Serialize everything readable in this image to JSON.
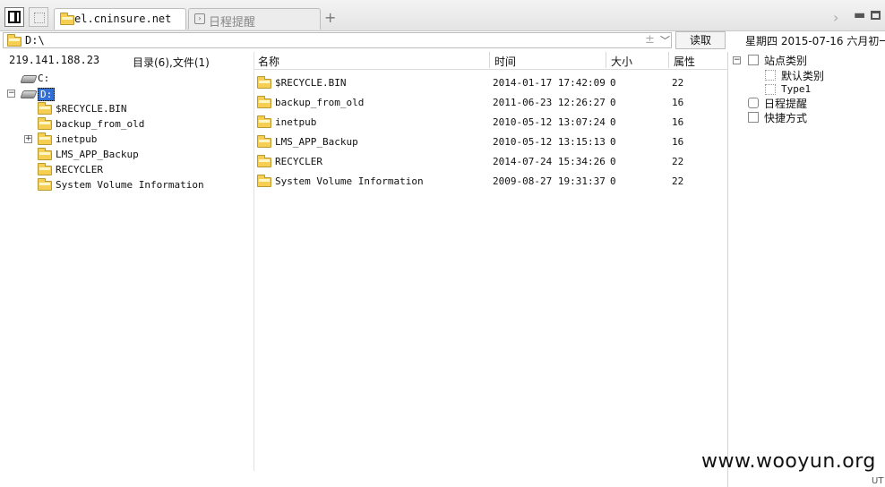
{
  "tabs": [
    {
      "label": "el.cninsure.net",
      "active": true
    },
    {
      "label": "日程提醒",
      "active": false
    }
  ],
  "new_tab_label": "+",
  "address": {
    "value": "D:\\",
    "plus_label": "±"
  },
  "read_button": "读取",
  "date_label": "星期四 2015-07-16 六月初一",
  "left": {
    "ip": "219.141.188.23",
    "dir_count": "目录(6),文件(1)",
    "drives": [
      {
        "label": "C:"
      },
      {
        "label": "D:"
      }
    ],
    "tree": [
      "$RECYCLE.BIN",
      "backup_from_old",
      "inetpub",
      "LMS_APP_Backup",
      "RECYCLER",
      "System Volume Information"
    ],
    "expander_minus": "−",
    "expander_plus": "+"
  },
  "columns": {
    "name": "名称",
    "time": "时间",
    "size": "大小",
    "attr": "属性"
  },
  "files": [
    {
      "name": "$RECYCLE.BIN",
      "time": "2014-01-17 17:42:09",
      "size": "0",
      "attr": "22"
    },
    {
      "name": "backup_from_old",
      "time": "2011-06-23 12:26:27",
      "size": "0",
      "attr": "16"
    },
    {
      "name": "inetpub",
      "time": "2010-05-12 13:07:24",
      "size": "0",
      "attr": "16"
    },
    {
      "name": "LMS_APP_Backup",
      "time": "2010-05-12 13:15:13",
      "size": "0",
      "attr": "16"
    },
    {
      "name": "RECYCLER",
      "time": "2014-07-24 15:34:26",
      "size": "0",
      "attr": "22"
    },
    {
      "name": "System Volume Information",
      "time": "2009-08-27 19:31:37",
      "size": "0",
      "attr": "22"
    }
  ],
  "right": {
    "root": "站点类别",
    "children": [
      "默认类别",
      "Type1"
    ],
    "schedule": "日程提醒",
    "shortcuts": "快捷方式",
    "expander": "−"
  },
  "watermark": "www.wooyun.org",
  "status_text": "UT",
  "icons": {
    "folder": "folder-icon",
    "drive": "hard-drive-icon",
    "schedule": "calendar-icon",
    "shortcut": "shortcut-icon"
  },
  "colors": {
    "selection": "#2f6fd6",
    "folder": "#f6cf52"
  }
}
